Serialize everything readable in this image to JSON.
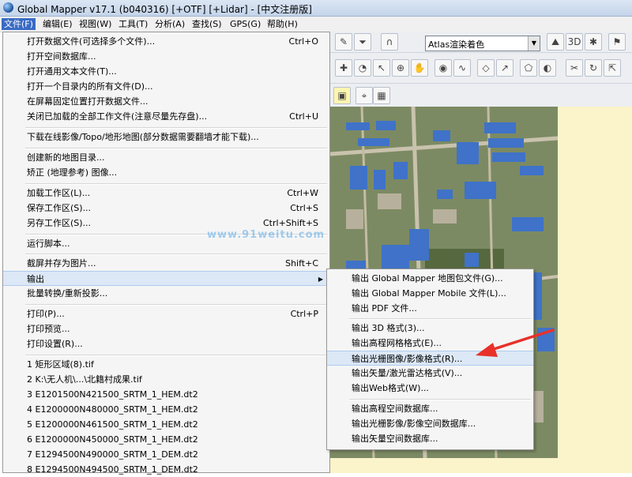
{
  "window": {
    "title": "Global Mapper v17.1 (b040316) [+OTF] [+Lidar] - [中文注册版]"
  },
  "menubar": [
    {
      "label": "文件(F)"
    },
    {
      "label": "编辑(E)"
    },
    {
      "label": "视图(W)"
    },
    {
      "label": "工具(T)"
    },
    {
      "label": "分析(A)"
    },
    {
      "label": "查找(S)"
    },
    {
      "label": "GPS(G)"
    },
    {
      "label": "帮助(H)"
    }
  ],
  "toolbar": {
    "shader_combo": "Atlas渲染着色"
  },
  "watermark": "www.91weitu.com",
  "file_menu": {
    "items": [
      {
        "label": "打开数据文件(可选择多个文件)...",
        "shortcut": "Ctrl+O"
      },
      {
        "label": "打开空间数据库...",
        "shortcut": ""
      },
      {
        "label": "打开通用文本文件(T)...",
        "shortcut": ""
      },
      {
        "label": "打开一个目录内的所有文件(D)...",
        "shortcut": ""
      },
      {
        "label": "在屏幕固定位置打开数据文件...",
        "shortcut": ""
      },
      {
        "label": "关闭已加载的全部工作文件(注意尽量先存盘)...",
        "shortcut": "Ctrl+U"
      },
      {
        "label": "下载在线影像/Topo/地形地图(部分数据需要翻墙才能下载)...",
        "shortcut": ""
      },
      {
        "label": "创建新的地图目录...",
        "shortcut": ""
      },
      {
        "label": "矫正 (地理参考) 图像...",
        "shortcut": ""
      },
      {
        "label": "加载工作区(L)...",
        "shortcut": "Ctrl+W"
      },
      {
        "label": "保存工作区(S)...",
        "shortcut": "Ctrl+S"
      },
      {
        "label": "另存工作区(S)...",
        "shortcut": "Ctrl+Shift+S"
      },
      {
        "label": "运行脚本...",
        "shortcut": ""
      },
      {
        "label": "截屏并存为图片...",
        "shortcut": "Shift+C"
      },
      {
        "label": "输出",
        "shortcut": ""
      },
      {
        "label": "批量转换/重新投影...",
        "shortcut": ""
      },
      {
        "label": "打印(P)...",
        "shortcut": "Ctrl+P"
      },
      {
        "label": "打印预览...",
        "shortcut": ""
      },
      {
        "label": "打印设置(R)...",
        "shortcut": ""
      },
      {
        "label": "1 矩形区域(8).tif",
        "shortcut": ""
      },
      {
        "label": "2 K:\\无人机\\...\\北籍村成果.tif",
        "shortcut": ""
      },
      {
        "label": "3 E1201500N421500_SRTM_1_HEM.dt2",
        "shortcut": ""
      },
      {
        "label": "4 E1200000N480000_SRTM_1_HEM.dt2",
        "shortcut": ""
      },
      {
        "label": "5 E1200000N461500_SRTM_1_HEM.dt2",
        "shortcut": ""
      },
      {
        "label": "6 E1200000N450000_SRTM_1_HEM.dt2",
        "shortcut": ""
      },
      {
        "label": "7 E1294500N490000_SRTM_1_DEM.dt2",
        "shortcut": ""
      },
      {
        "label": "8 E1294500N494500_SRTM_1_DEM.dt2",
        "shortcut": ""
      }
    ]
  },
  "export_submenu": {
    "items": [
      {
        "label": "输出 Global Mapper 地图包文件(G)..."
      },
      {
        "label": "输出 Global Mapper Mobile 文件(L)..."
      },
      {
        "label": "输出 PDF 文件..."
      },
      {
        "label": "输出 3D 格式(3)..."
      },
      {
        "label": "输出高程网格格式(E)..."
      },
      {
        "label": "输出光栅图像/影像格式(R)..."
      },
      {
        "label": "输出矢量/激光雷达格式(V)..."
      },
      {
        "label": "输出Web格式(W)..."
      },
      {
        "label": "输出高程空间数据库..."
      },
      {
        "label": "输出光栅影像/影像空间数据库..."
      },
      {
        "label": "输出矢量空间数据库..."
      }
    ]
  },
  "colors": {
    "menu_highlight": "#3a6bc4",
    "arrow": "#e8312a",
    "map_field": "#76875d",
    "roof_blue": "#3f72c8"
  }
}
